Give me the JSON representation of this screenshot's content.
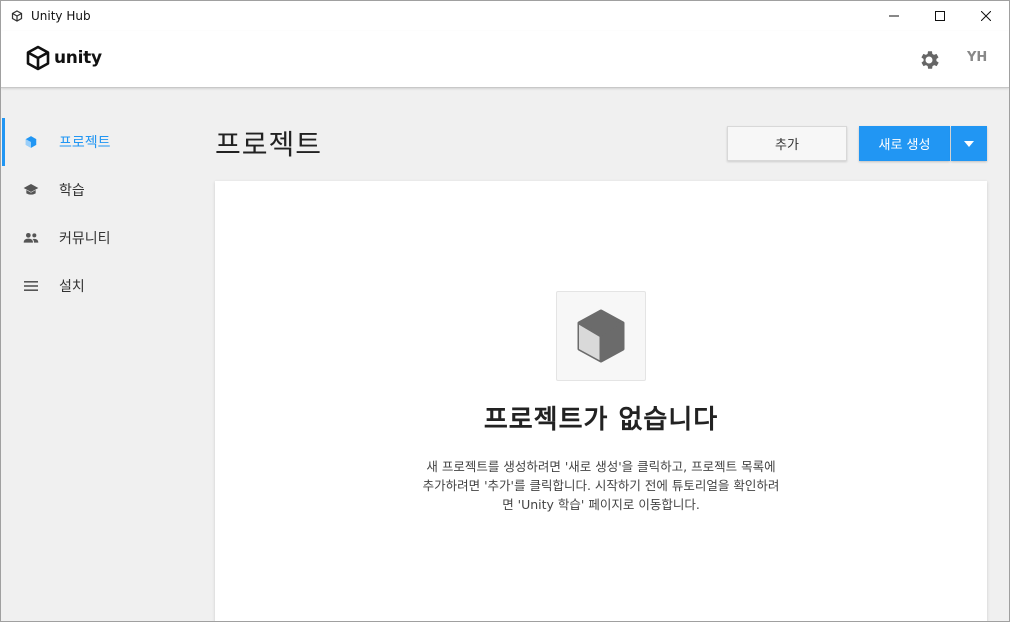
{
  "window": {
    "title": "Unity Hub",
    "controls": [
      "minimize-icon",
      "maximize-icon",
      "close-icon"
    ]
  },
  "header": {
    "logo_text": "unity",
    "settings_icon": "gear-icon",
    "avatar_initials": "YH"
  },
  "sidebar": {
    "items": [
      {
        "label": "프로젝트",
        "icon": "cube-icon",
        "active": true
      },
      {
        "label": "학습",
        "icon": "graduation-cap-icon",
        "active": false
      },
      {
        "label": "커뮤니티",
        "icon": "people-icon",
        "active": false
      },
      {
        "label": "설치",
        "icon": "list-icon",
        "active": false
      }
    ]
  },
  "main": {
    "title": "프로젝트",
    "add_button": "추가",
    "new_button": "새로 생성",
    "empty": {
      "title": "프로젝트가 없습니다",
      "desc_line1": "새 프로젝트를 생성하려면 '새로 생성'을 클릭하고, 프로젝트 목록에",
      "desc_line2": "추가하려면 '추가'를 클릭합니다. 시작하기 전에 튜토리얼을 확인하려",
      "desc_line3": "면 'Unity 학습' 페이지로 이동합니다."
    }
  },
  "colors": {
    "accent": "#2196f3",
    "background": "#f0f0f0",
    "panel": "#ffffff"
  }
}
